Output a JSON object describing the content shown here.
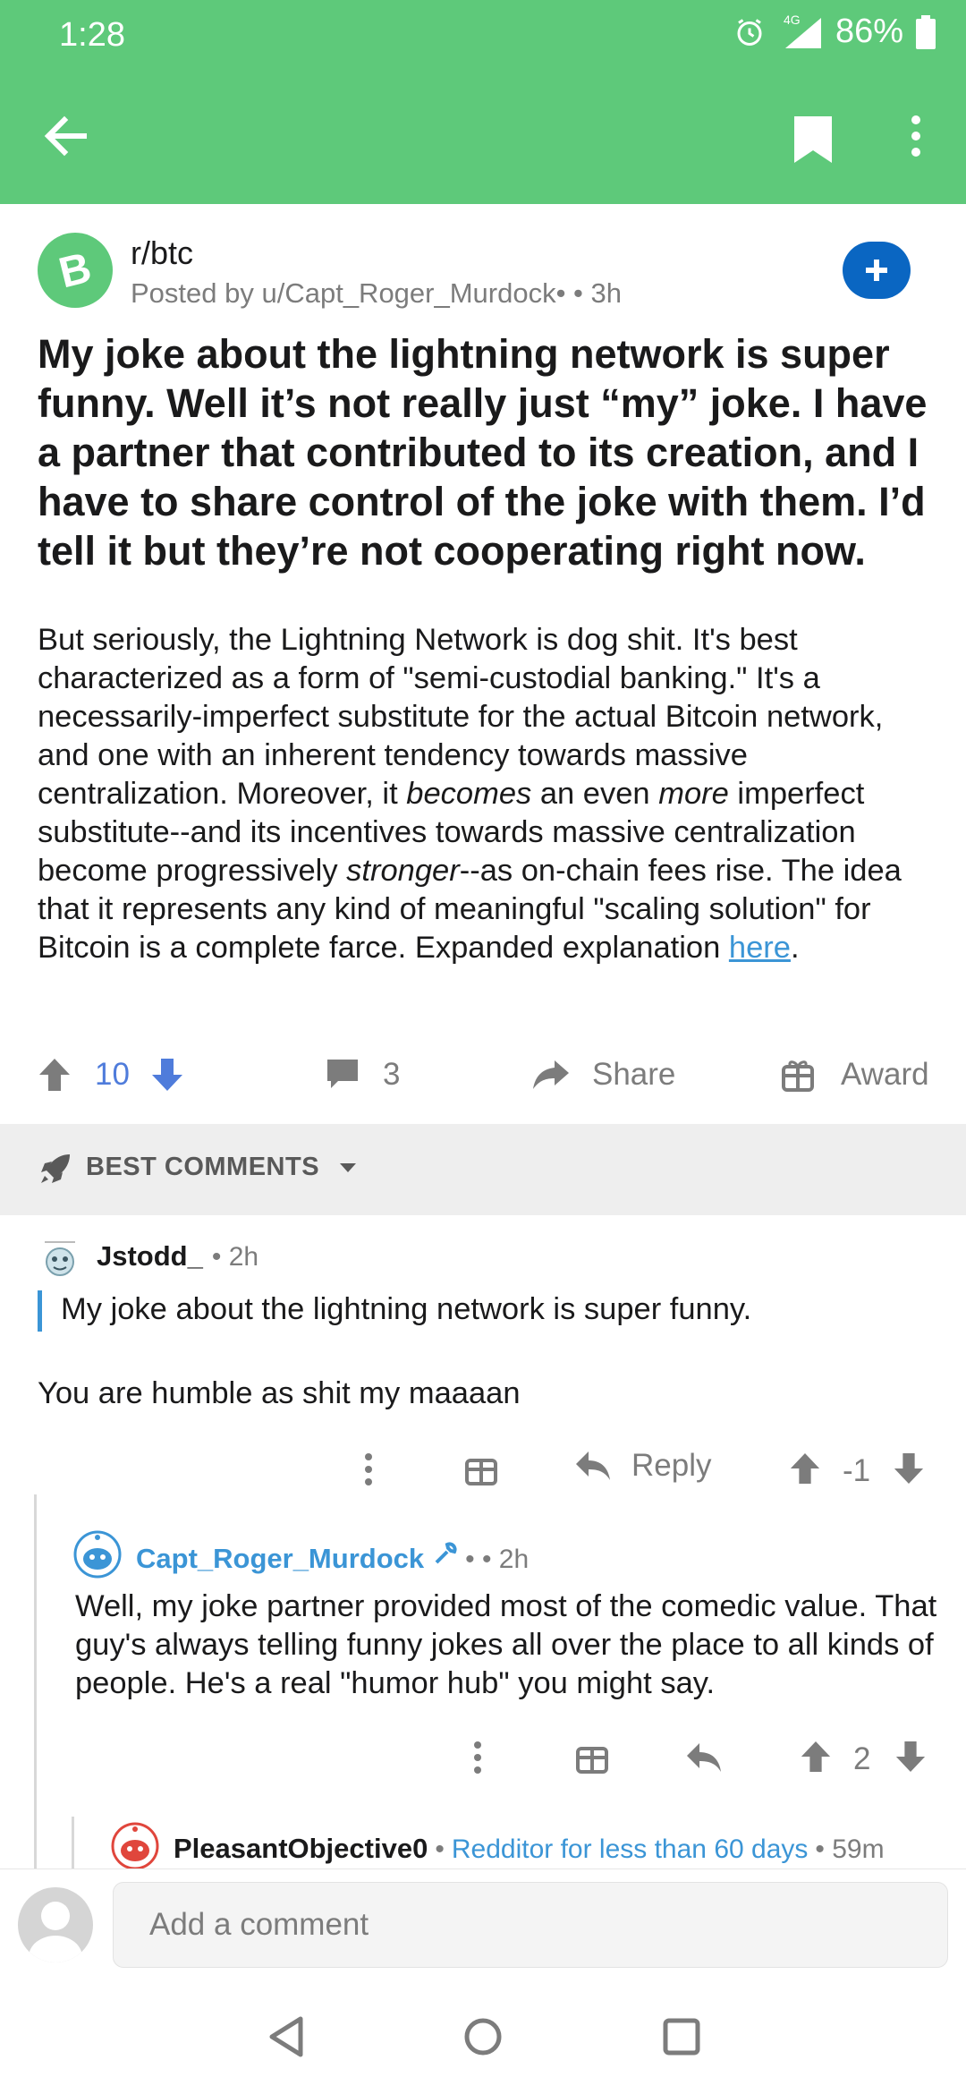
{
  "status": {
    "time": "1:28",
    "network": "4G",
    "battery": "86%"
  },
  "appbar": {
    "bg_color": "#5ec97a"
  },
  "post": {
    "subreddit": "r/btc",
    "posted_by": "Posted by u/Capt_Roger_Murdock• • 3h",
    "title": "My joke about the lightning network is super funny. Well it’s not really just “my” joke. I have a partner that contributed to its creation, and I have to share control of the joke with them. I’d tell it but they’re not cooperating right now.",
    "body": {
      "p1": "But seriously, the Lightning Network is dog shit. It's best characterized as a form of \"semi-custodial banking.\"  It's a necessarily-imperfect substitute for the actual Bitcoin network, and one with an inherent tendency towards massive centralization. Moreover, it ",
      "em1": "becomes",
      "p2": " an even ",
      "em2": "more",
      "p3": " imperfect substitute--and its incentives towards massive centralization become progressively ",
      "em3": "stronger",
      "p4": "--as on-chain fees rise. The idea that it represents any kind of meaningful \"scaling solution\" for Bitcoin is a complete farce.  Expanded explanation ",
      "link": "here",
      "end": "."
    },
    "score": "10",
    "comments_count": "3",
    "share_label": "Share",
    "award_label": "Award"
  },
  "sort": {
    "label": "BEST COMMENTS"
  },
  "comments": [
    {
      "author": "Jstodd_",
      "meta": "• 2h",
      "quote": "My joke about the lightning network is super funny.",
      "text": "You are humble as shit my maaaan",
      "reply_label": "Reply",
      "score": "-1"
    },
    {
      "author": "Capt_Roger_Murdock",
      "meta": "• • 2h",
      "text": "Well, my joke partner provided most of the comedic value. That guy's always telling funny jokes all over the place to all kinds of people. He's a real \"humor hub\" you might say.",
      "score": "2"
    },
    {
      "author": "PleasantObjective0",
      "flair": "Redditor for less than 60 days",
      "meta": "• 59m",
      "sep": "•"
    }
  ],
  "composer": {
    "placeholder": "Add a comment"
  },
  "colors": {
    "accent_blue": "#3b95d6",
    "vote_blue": "#4f7cdb",
    "join_blue": "#0a66c2"
  }
}
